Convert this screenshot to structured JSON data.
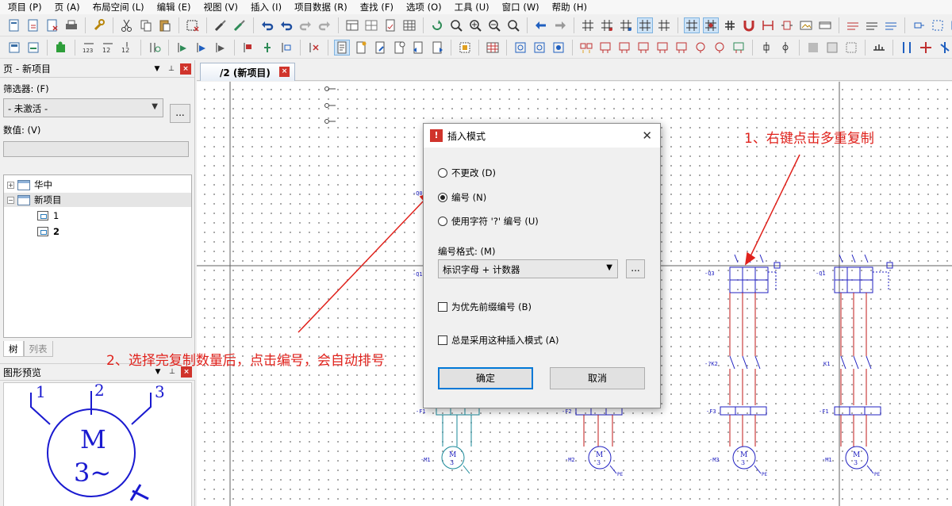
{
  "menu": [
    "项目 (P)",
    "页 (A)",
    "布局空间 (L)",
    "编辑 (E)",
    "视图 (V)",
    "插入 (I)",
    "项目数据 (R)",
    "查找 (F)",
    "选项 (O)",
    "工具 (U)",
    "窗口 (W)",
    "帮助 (H)"
  ],
  "page_panel": {
    "title": "页 - 新项目",
    "filter_label": "筛选器: (F)",
    "filter_value": "- 未激活 -",
    "dots": "...",
    "value_label": "数值: (V)",
    "tree": {
      "root": "华中",
      "project": "新项目",
      "page1": "1",
      "page2": "2"
    },
    "tab_tree": "树",
    "tab_list": "列表"
  },
  "preview_panel": {
    "title": "图形预览",
    "motor_letter": "M",
    "motor_phase": "3~",
    "pin1": "1",
    "pin2": "2",
    "pin3": "3"
  },
  "doc_tab": {
    "title": "/2 (新项目)"
  },
  "canvas": {
    "label_q_left_a": "-Q0",
    "label_q_left_b": "-Q1",
    "label_q3": "-Q3",
    "label_q1": "-Q1",
    "label_k2": "-?K2",
    "label_k1": "K1",
    "label_f1": "-F1",
    "label_f2": "-F2",
    "label_f3": "-F3",
    "label_f1b": "-F1",
    "label_m1": "-M1",
    "label_m2": "-M2",
    "label_m3": "-M3",
    "label_m1b": "-M1",
    "motor_m": "M",
    "motor_3": "3",
    "pe": "PE"
  },
  "annotations": {
    "step1": "1、右键点击多重复制",
    "step2": "2、选择完复制数量后，点击编号，会自动排号"
  },
  "dialog": {
    "title": "插入模式",
    "opt_no_change": "不更改 (D)",
    "opt_number": "编号 (N)",
    "opt_char": "使用字符 '?' 编号 (U)",
    "selected_option": "编号 (N)",
    "format_label": "编号格式: (M)",
    "format_value": "标识字母 + 计数器",
    "dots": "...",
    "chk_prefix": "为优先前缀编号 (B)",
    "chk_always": "总是采用这种插入模式 (A)",
    "ok": "确定",
    "cancel": "取消"
  },
  "colors": {
    "annotation": "#e0221c",
    "schematic_blue": "#2020c0",
    "schematic_red": "#c01818",
    "schematic_teal": "#1a8a9a",
    "warning_icon": "#d0342c"
  }
}
